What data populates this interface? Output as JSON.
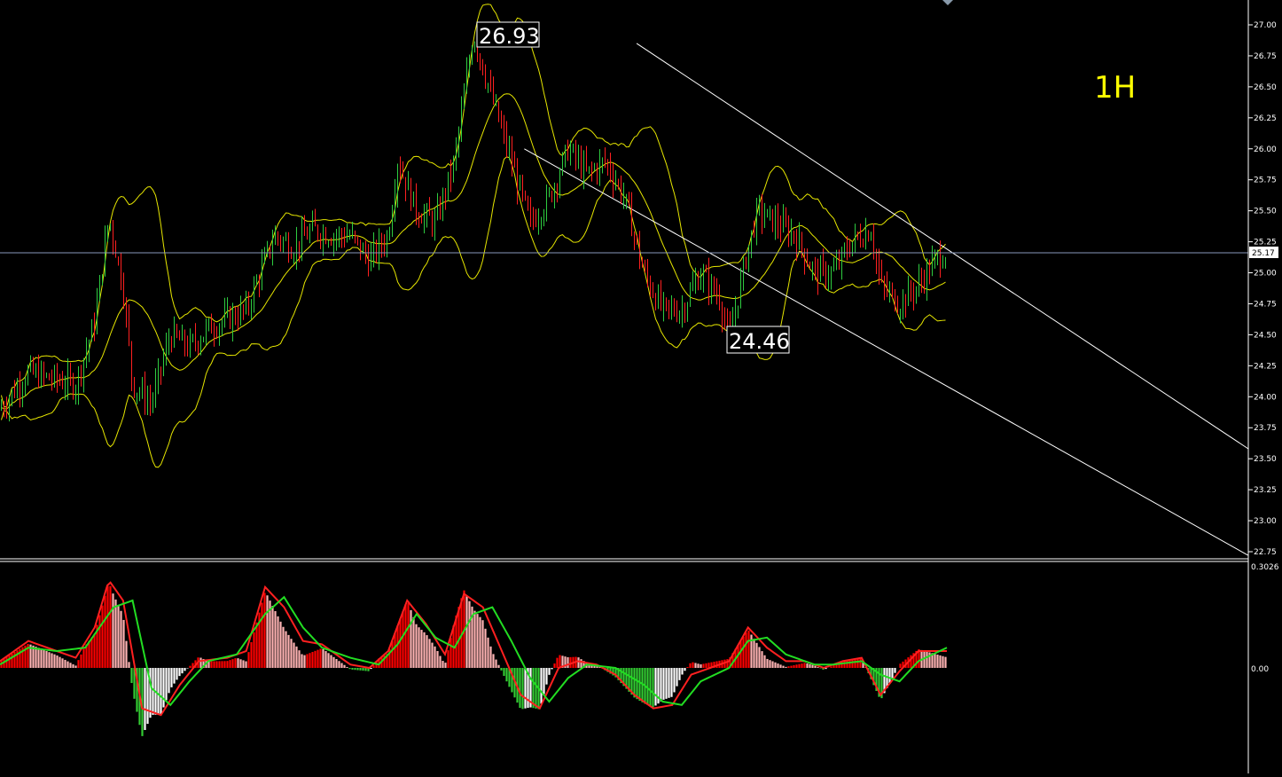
{
  "timeframe_label": "1H",
  "price_axis": {
    "ticks": [
      "27.00",
      "26.75",
      "26.50",
      "26.25",
      "26.00",
      "25.75",
      "25.50",
      "25.25",
      "25.00",
      "24.75",
      "24.50",
      "24.25",
      "24.00",
      "23.75",
      "23.50",
      "23.25",
      "23.00",
      "22.75"
    ],
    "current_price": "25.17"
  },
  "annotations": {
    "high_label": "26.93",
    "low_label": "24.46"
  },
  "indicator_axis": {
    "top_label": "0.3026",
    "zero_label": "0.00"
  },
  "colors": {
    "background": "#000000",
    "candle_up": "#2ecc40",
    "candle_down": "#ff2020",
    "bollinger": "#e6e600",
    "channel": "#ffffff",
    "hist_pos_strong": "#ff0000",
    "hist_pos_weak": "#ffb3b3",
    "hist_neg_strong": "#33cc33",
    "hist_neg_weak": "#ffffff",
    "macd_line": "#ff2020",
    "signal_line": "#22dd22",
    "label": "#ffff00"
  },
  "chart_data": {
    "type": "line",
    "ylim": [
      22.7,
      27.1
    ],
    "indicator_ylim": [
      -0.33,
      0.3026
    ],
    "trend_channel": {
      "upper": [
        [
          0.51,
          26.85
        ],
        [
          1.0,
          23.58
        ]
      ],
      "lower": [
        [
          0.42,
          26.0
        ],
        [
          1.0,
          22.72
        ]
      ]
    },
    "price_path": [
      [
        0.0,
        23.9
      ],
      [
        0.03,
        24.2
      ],
      [
        0.05,
        24.15
      ],
      [
        0.08,
        24.1
      ],
      [
        0.1,
        24.6
      ],
      [
        0.115,
        25.45
      ],
      [
        0.13,
        24.9
      ],
      [
        0.14,
        24.1
      ],
      [
        0.16,
        23.95
      ],
      [
        0.18,
        24.5
      ],
      [
        0.2,
        24.4
      ],
      [
        0.22,
        24.55
      ],
      [
        0.26,
        24.7
      ],
      [
        0.29,
        25.3
      ],
      [
        0.31,
        25.2
      ],
      [
        0.33,
        25.35
      ],
      [
        0.35,
        25.3
      ],
      [
        0.37,
        25.3
      ],
      [
        0.39,
        25.1
      ],
      [
        0.41,
        25.3
      ],
      [
        0.42,
        25.9
      ],
      [
        0.44,
        25.5
      ],
      [
        0.46,
        25.4
      ],
      [
        0.48,
        25.9
      ],
      [
        0.5,
        26.93
      ],
      [
        0.52,
        26.4
      ],
      [
        0.54,
        25.9
      ],
      [
        0.56,
        25.4
      ],
      [
        0.58,
        25.6
      ],
      [
        0.6,
        26.0
      ],
      [
        0.62,
        25.8
      ],
      [
        0.64,
        25.9
      ],
      [
        0.66,
        25.6
      ],
      [
        0.68,
        25.0
      ],
      [
        0.7,
        24.7
      ],
      [
        0.72,
        24.7
      ],
      [
        0.74,
        25.0
      ],
      [
        0.76,
        24.8
      ],
      [
        0.77,
        24.46
      ],
      [
        0.79,
        25.2
      ],
      [
        0.8,
        25.5
      ],
      [
        0.82,
        25.4
      ],
      [
        0.84,
        25.3
      ],
      [
        0.86,
        25.0
      ],
      [
        0.88,
        25.0
      ],
      [
        0.9,
        25.25
      ],
      [
        0.92,
        25.35
      ],
      [
        0.93,
        24.9
      ],
      [
        0.95,
        24.75
      ],
      [
        0.97,
        24.9
      ],
      [
        0.99,
        25.12
      ],
      [
        1.0,
        25.17
      ]
    ],
    "macd_path": [
      [
        0.0,
        0.02
      ],
      [
        0.03,
        0.08
      ],
      [
        0.05,
        0.06
      ],
      [
        0.08,
        0.03
      ],
      [
        0.1,
        0.12
      ],
      [
        0.115,
        0.26
      ],
      [
        0.13,
        0.2
      ],
      [
        0.15,
        -0.12
      ],
      [
        0.17,
        -0.14
      ],
      [
        0.19,
        -0.05
      ],
      [
        0.21,
        0.02
      ],
      [
        0.24,
        0.03
      ],
      [
        0.26,
        0.05
      ],
      [
        0.28,
        0.24
      ],
      [
        0.3,
        0.18
      ],
      [
        0.32,
        0.08
      ],
      [
        0.34,
        0.07
      ],
      [
        0.37,
        0.01
      ],
      [
        0.39,
        0.0
      ],
      [
        0.41,
        0.05
      ],
      [
        0.43,
        0.2
      ],
      [
        0.45,
        0.13
      ],
      [
        0.47,
        0.04
      ],
      [
        0.49,
        0.22
      ],
      [
        0.51,
        0.18
      ],
      [
        0.53,
        0.05
      ],
      [
        0.55,
        -0.08
      ],
      [
        0.57,
        -0.12
      ],
      [
        0.59,
        0.0
      ],
      [
        0.61,
        0.02
      ],
      [
        0.63,
        0.01
      ],
      [
        0.65,
        -0.02
      ],
      [
        0.67,
        -0.08
      ],
      [
        0.69,
        -0.12
      ],
      [
        0.71,
        -0.11
      ],
      [
        0.73,
        -0.02
      ],
      [
        0.75,
        0.0
      ],
      [
        0.77,
        0.02
      ],
      [
        0.79,
        0.12
      ],
      [
        0.81,
        0.06
      ],
      [
        0.83,
        0.02
      ],
      [
        0.85,
        0.02
      ],
      [
        0.87,
        0.0
      ],
      [
        0.89,
        0.02
      ],
      [
        0.91,
        0.03
      ],
      [
        0.93,
        -0.08
      ],
      [
        0.95,
        -0.01
      ],
      [
        0.97,
        0.05
      ],
      [
        1.0,
        0.05
      ]
    ],
    "signal_path": [
      [
        0.0,
        0.01
      ],
      [
        0.03,
        0.06
      ],
      [
        0.06,
        0.05
      ],
      [
        0.09,
        0.06
      ],
      [
        0.12,
        0.18
      ],
      [
        0.14,
        0.2
      ],
      [
        0.16,
        -0.06
      ],
      [
        0.18,
        -0.11
      ],
      [
        0.2,
        -0.04
      ],
      [
        0.22,
        0.02
      ],
      [
        0.25,
        0.04
      ],
      [
        0.28,
        0.16
      ],
      [
        0.3,
        0.21
      ],
      [
        0.32,
        0.12
      ],
      [
        0.34,
        0.06
      ],
      [
        0.37,
        0.03
      ],
      [
        0.4,
        0.01
      ],
      [
        0.42,
        0.07
      ],
      [
        0.44,
        0.16
      ],
      [
        0.46,
        0.09
      ],
      [
        0.48,
        0.06
      ],
      [
        0.5,
        0.16
      ],
      [
        0.52,
        0.18
      ],
      [
        0.54,
        0.08
      ],
      [
        0.56,
        -0.03
      ],
      [
        0.58,
        -0.1
      ],
      [
        0.6,
        -0.03
      ],
      [
        0.62,
        0.01
      ],
      [
        0.65,
        0.0
      ],
      [
        0.68,
        -0.05
      ],
      [
        0.7,
        -0.1
      ],
      [
        0.72,
        -0.11
      ],
      [
        0.74,
        -0.04
      ],
      [
        0.77,
        0.0
      ],
      [
        0.79,
        0.08
      ],
      [
        0.81,
        0.09
      ],
      [
        0.83,
        0.04
      ],
      [
        0.86,
        0.01
      ],
      [
        0.88,
        0.01
      ],
      [
        0.91,
        0.02
      ],
      [
        0.93,
        -0.02
      ],
      [
        0.95,
        -0.04
      ],
      [
        0.97,
        0.02
      ],
      [
        1.0,
        0.06
      ]
    ]
  }
}
